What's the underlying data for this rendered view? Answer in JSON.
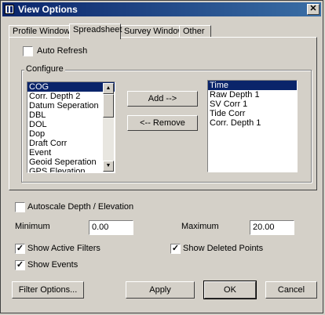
{
  "window": {
    "title": "View Options",
    "close_glyph": "✕"
  },
  "tabs": [
    {
      "label": "Profile Window"
    },
    {
      "label": "Spreadsheet",
      "active": true
    },
    {
      "label": "Survey Window"
    },
    {
      "label": "Other"
    }
  ],
  "spreadsheet": {
    "auto_refresh_label": "Auto Refresh",
    "auto_refresh_checked": false,
    "configure_label": "Configure",
    "available_items": [
      "COG",
      "Corr. Depth 2",
      "Datum Seperation",
      "DBL",
      "DOL",
      "Dop",
      "Draft Corr",
      "Event",
      "Geoid Seperation",
      "GPS Elevation"
    ],
    "available_selected": "COG",
    "add_button": "Add -->",
    "remove_button": "<-- Remove",
    "selected_items": [
      "Time",
      "Raw Depth 1",
      "SV Corr 1",
      "Tide Corr",
      "Corr. Depth 1"
    ],
    "selected_highlight": "Time"
  },
  "options": {
    "autoscale_label": "Autoscale Depth / Elevation",
    "autoscale_checked": false,
    "minimum_label": "Minimum",
    "minimum_value": "0.00",
    "maximum_label": "Maximum",
    "maximum_value": "20.00",
    "show_active_filters_label": "Show Active Filters",
    "show_active_filters_checked": true,
    "show_deleted_points_label": "Show Deleted Points",
    "show_deleted_points_checked": true,
    "show_events_label": "Show Events",
    "show_events_checked": true
  },
  "buttons": {
    "filter_options": "Filter Options...",
    "apply": "Apply",
    "ok": "OK",
    "cancel": "Cancel"
  },
  "check_glyph": "✓",
  "colors": {
    "titlebar": "#0a246a",
    "selection": "#0a246a",
    "face": "#d4d0c8"
  }
}
